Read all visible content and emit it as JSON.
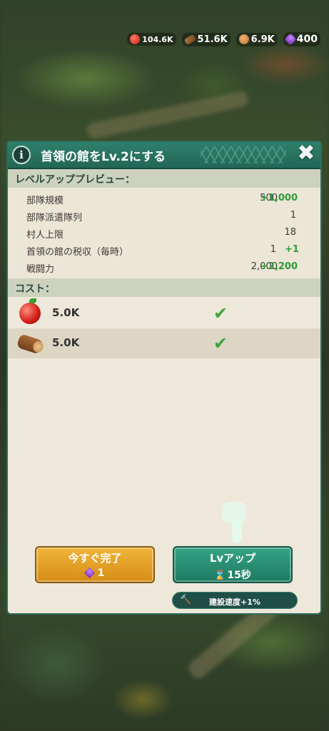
{
  "resources": {
    "food": "104.6K",
    "wood": "51.6K",
    "bread": "6.9K",
    "gems": "400"
  },
  "dialog": {
    "title": "首領の館をLv.2にする",
    "info_label": "i",
    "close_label": "✖",
    "preview_header": "レベルアッププレビュー：",
    "stats": [
      {
        "label": "部隊規模",
        "current": "500",
        "increase": "+1,000"
      },
      {
        "label": "部隊派遣隊列",
        "current": "1",
        "increase": ""
      },
      {
        "label": "村人上限",
        "current": "18",
        "increase": ""
      },
      {
        "label": "首領の館の税収（毎時）",
        "current": "1",
        "increase": "+1"
      },
      {
        "label": "戦闘力",
        "current": "2,000",
        "increase": "+2,200"
      }
    ],
    "cost_header": "コスト：",
    "costs": [
      {
        "item": "apple",
        "amount": "5.0K",
        "met": "✔"
      },
      {
        "item": "log",
        "amount": "5.0K",
        "met": "✔"
      }
    ],
    "finish_now": {
      "label": "今すぐ完了",
      "gem_cost": "1"
    },
    "level_up": {
      "label": "Lvアップ",
      "time": "15秒"
    },
    "speed_bonus": "建設速度+1%"
  },
  "colors": {
    "header": "#2f806b",
    "panel": "#eee8da",
    "increase_green": "#2e9a38",
    "finish_button": "#f0b53a",
    "levelup_button": "#36a384"
  }
}
